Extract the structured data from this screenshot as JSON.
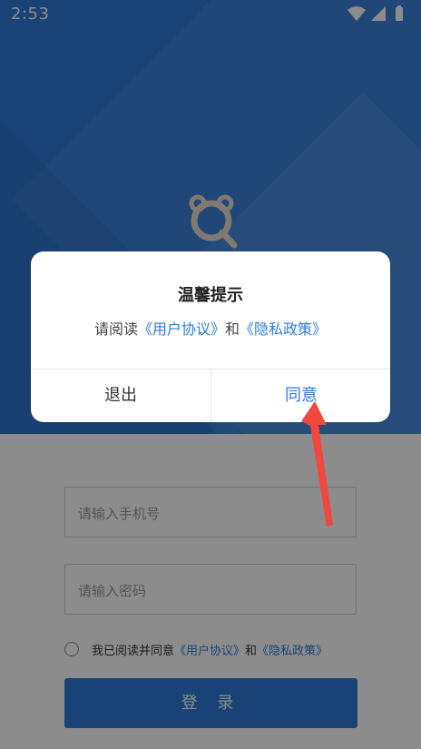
{
  "status_bar": {
    "time": "2:53",
    "icons": [
      "wifi-icon",
      "signal-icon",
      "battery-icon"
    ]
  },
  "form": {
    "phone_placeholder": "请输入手机号",
    "password_placeholder": "请输入密码",
    "agree_prefix": "我已阅读并同意",
    "user_agreement": "《用户协议》",
    "conjunction": "和",
    "privacy_policy": "《隐私政策》",
    "login_label": "登 录"
  },
  "dialog": {
    "title": "温馨提示",
    "message_prefix": "请阅读",
    "user_agreement": "《用户协议》",
    "conjunction": "和",
    "privacy_policy": "《隐私政策》",
    "exit_label": "退出",
    "agree_label": "同意"
  },
  "colors": {
    "brand_blue": "#2f7bd8",
    "arrow_red": "#f0483e"
  }
}
